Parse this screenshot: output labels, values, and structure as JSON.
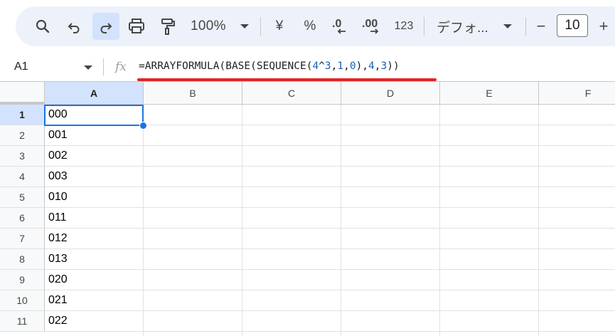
{
  "toolbar": {
    "zoom_label": "100%",
    "currency_label": "¥",
    "percent_label": "%",
    "decrease_decimal_label": ".0",
    "increase_decimal_label": ".00",
    "number_format_label": "123",
    "font_label": "デフォ...",
    "font_size_value": "10",
    "decrease_size_label": "−",
    "increase_size_label": "+"
  },
  "formula_bar": {
    "name_box": "A1",
    "fx_label": "fx",
    "formula_parts": [
      {
        "t": "=ARRAYFORMULA(BASE(SEQUENCE(",
        "c": "text"
      },
      {
        "t": "4",
        "c": "num"
      },
      {
        "t": "^",
        "c": "text"
      },
      {
        "t": "3",
        "c": "num"
      },
      {
        "t": ",",
        "c": "text"
      },
      {
        "t": "1",
        "c": "num"
      },
      {
        "t": ",",
        "c": "text"
      },
      {
        "t": "0",
        "c": "num"
      },
      {
        "t": "),",
        "c": "text"
      },
      {
        "t": "4",
        "c": "num"
      },
      {
        "t": ",",
        "c": "text"
      },
      {
        "t": "3",
        "c": "num"
      },
      {
        "t": "))",
        "c": "text"
      }
    ]
  },
  "grid": {
    "columns": [
      "A",
      "B",
      "C",
      "D",
      "E",
      "F"
    ],
    "selected_column": "A",
    "rows": [
      {
        "num": "1",
        "a": "000"
      },
      {
        "num": "2",
        "a": "001"
      },
      {
        "num": "3",
        "a": "002"
      },
      {
        "num": "4",
        "a": "003"
      },
      {
        "num": "5",
        "a": "010"
      },
      {
        "num": "6",
        "a": "011"
      },
      {
        "num": "7",
        "a": "012"
      },
      {
        "num": "8",
        "a": "013"
      },
      {
        "num": "9",
        "a": "020"
      },
      {
        "num": "10",
        "a": "021"
      },
      {
        "num": "11",
        "a": "022"
      }
    ],
    "selected_row": "1"
  },
  "colors": {
    "accent": "#1a73e8",
    "toolbar_bg": "#edf2fa",
    "highlight_underline": "#e32423",
    "formula_number": "#1a5fb4"
  }
}
